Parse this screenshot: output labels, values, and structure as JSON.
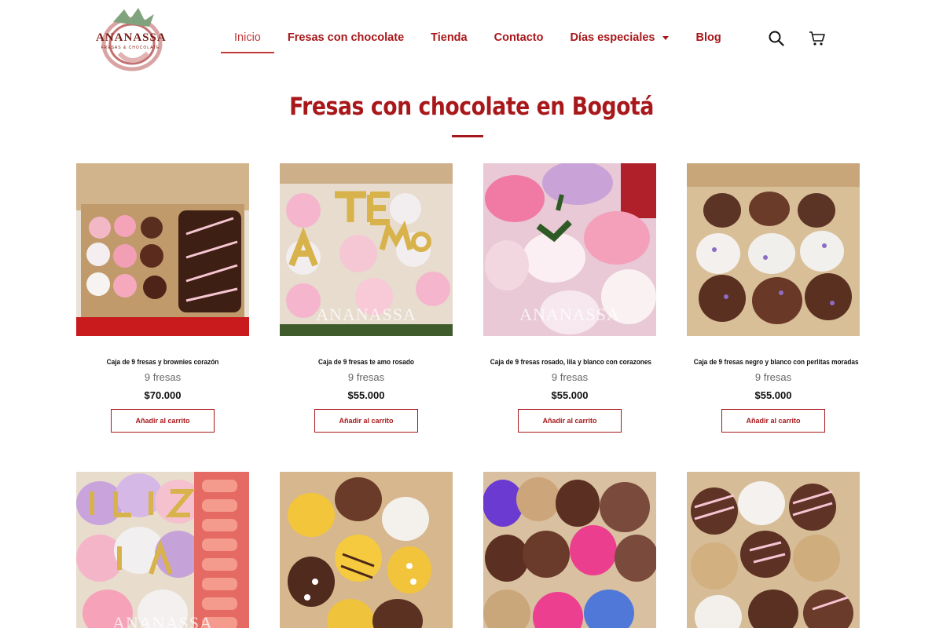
{
  "brand": {
    "logo_text": "ANANASSA",
    "logo_sub": "FRESAS & CHOCOLATE",
    "accent": "#a8171a"
  },
  "nav": {
    "items": [
      {
        "label": "Inicio",
        "active": true
      },
      {
        "label": "Fresas con chocolate"
      },
      {
        "label": "Tienda"
      },
      {
        "label": "Contacto"
      },
      {
        "label": "Días especiales",
        "has_dropdown": true
      },
      {
        "label": "Blog"
      }
    ],
    "icons": [
      "search-icon",
      "cart-icon"
    ]
  },
  "page": {
    "title": "Fresas con chocolate en Bogotá"
  },
  "products": [
    {
      "name": "Caja de 9 fresas y brownies corazón",
      "count": "9 fresas",
      "price": "$70.000",
      "button": "Añadir al carrito"
    },
    {
      "name": "Caja de 9 fresas te amo rosado",
      "count": "9 fresas",
      "price": "$55.000",
      "button": "Añadir al carrito",
      "letters": "TE AMO",
      "watermark": "ANANASSA"
    },
    {
      "name": "Caja de 9 fresas rosado, lila y blanco con corazones",
      "count": "9 fresas",
      "price": "$55.000",
      "button": "Añadir al carrito",
      "watermark": "ANANASSA"
    },
    {
      "name": "Caja de 9 fresas negro y blanco con perlitas moradas",
      "count": "9 fresas",
      "price": "$55.000",
      "button": "Añadir al carrito"
    },
    {
      "letters": "ELIZ IA",
      "watermark": "ANANASSA"
    },
    {},
    {},
    {}
  ]
}
